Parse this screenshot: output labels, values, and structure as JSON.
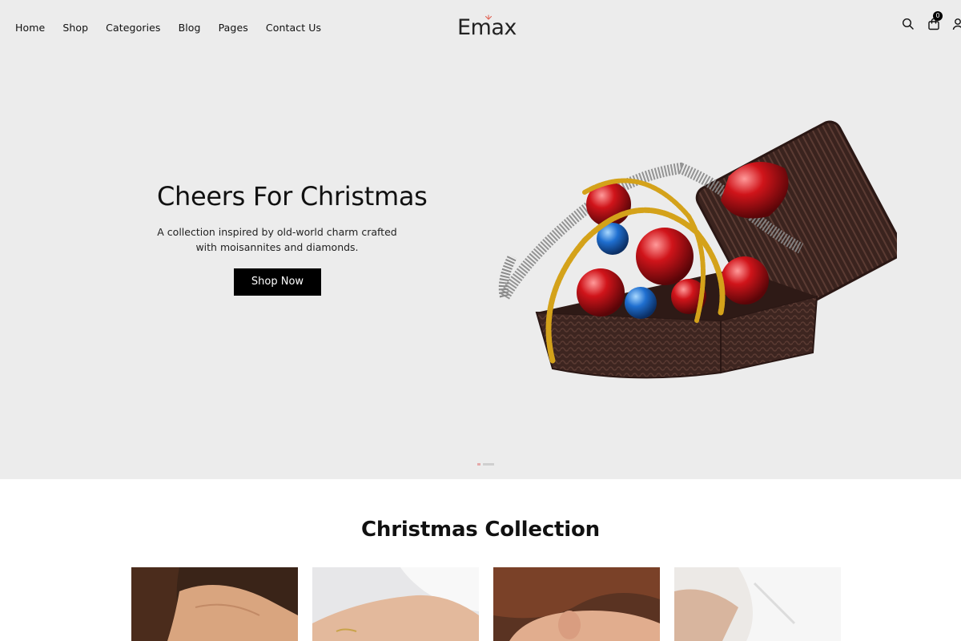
{
  "header": {
    "nav": [
      "Home",
      "Shop",
      "Categories",
      "Blog",
      "Pages",
      "Contact Us"
    ],
    "logo": "Emax",
    "cart_count": "0",
    "icons": [
      "search-icon",
      "cart-icon",
      "user-icon"
    ]
  },
  "hero": {
    "title": "Cheers For Christmas",
    "subtitle_line1": "A collection inspired by old-world charm crafted",
    "subtitle_line2": "with moisannites and diamonds.",
    "button": "Shop Now",
    "slide_count": 2,
    "active_slide": 1
  },
  "collection": {
    "title": "Christmas Collection",
    "cards": [
      "model-neck-photo",
      "wrist-bracelet-photo",
      "ear-earring-photo",
      "shirt-collar-photo"
    ]
  },
  "colors": {
    "hero_bg": "#ececec",
    "button_bg": "#000000",
    "accent_dot": "#e5a9a9"
  }
}
